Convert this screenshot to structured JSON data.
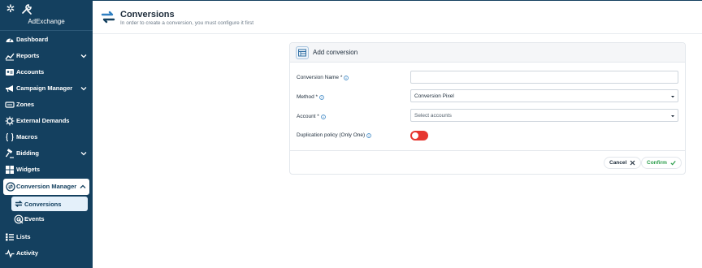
{
  "sidebar": {
    "brand": "AdExchange",
    "items": [
      {
        "label": "Dashboard"
      },
      {
        "label": "Reports"
      },
      {
        "label": "Accounts"
      },
      {
        "label": "Campaign Manager"
      },
      {
        "label": "Zones"
      },
      {
        "label": "External Demands"
      },
      {
        "label": "Macros"
      },
      {
        "label": "Bidding"
      },
      {
        "label": "Widgets"
      },
      {
        "label": "Conversion Manager"
      },
      {
        "label": "Conversions"
      },
      {
        "label": "Events"
      },
      {
        "label": "Lists"
      },
      {
        "label": "Activity"
      }
    ]
  },
  "header": {
    "title": "Conversions",
    "subtitle": "In order to create a conversion, you must configure it first"
  },
  "form": {
    "title": "Add conversion",
    "name_label": "Conversion Name *",
    "name_value": "",
    "method_label": "Method *",
    "method_value": "Conversion Pixel",
    "account_label": "Account *",
    "account_placeholder": "Select accounts",
    "duplication_label": "Duplication policy (Only One)",
    "duplication_enabled": false,
    "cancel_label": "Cancel",
    "confirm_label": "Confirm"
  },
  "colors": {
    "sidebar": "#14405f",
    "toggle": "#e6362f",
    "confirm": "#2a9d4a"
  }
}
